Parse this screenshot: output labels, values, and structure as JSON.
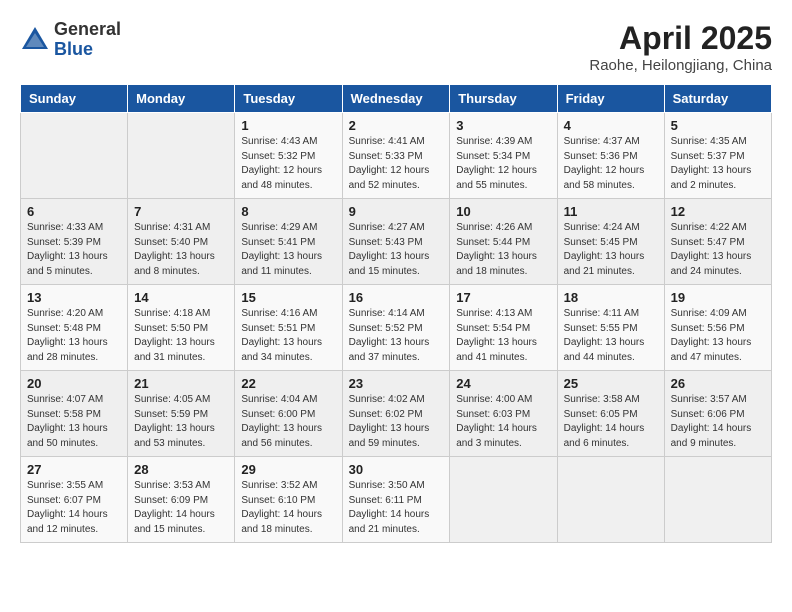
{
  "header": {
    "logo_general": "General",
    "logo_blue": "Blue",
    "title": "April 2025",
    "location": "Raohe, Heilongjiang, China"
  },
  "days_of_week": [
    "Sunday",
    "Monday",
    "Tuesday",
    "Wednesday",
    "Thursday",
    "Friday",
    "Saturday"
  ],
  "weeks": [
    [
      {
        "day": "",
        "info": ""
      },
      {
        "day": "",
        "info": ""
      },
      {
        "day": "1",
        "info": "Sunrise: 4:43 AM\nSunset: 5:32 PM\nDaylight: 12 hours\nand 48 minutes."
      },
      {
        "day": "2",
        "info": "Sunrise: 4:41 AM\nSunset: 5:33 PM\nDaylight: 12 hours\nand 52 minutes."
      },
      {
        "day": "3",
        "info": "Sunrise: 4:39 AM\nSunset: 5:34 PM\nDaylight: 12 hours\nand 55 minutes."
      },
      {
        "day": "4",
        "info": "Sunrise: 4:37 AM\nSunset: 5:36 PM\nDaylight: 12 hours\nand 58 minutes."
      },
      {
        "day": "5",
        "info": "Sunrise: 4:35 AM\nSunset: 5:37 PM\nDaylight: 13 hours\nand 2 minutes."
      }
    ],
    [
      {
        "day": "6",
        "info": "Sunrise: 4:33 AM\nSunset: 5:39 PM\nDaylight: 13 hours\nand 5 minutes."
      },
      {
        "day": "7",
        "info": "Sunrise: 4:31 AM\nSunset: 5:40 PM\nDaylight: 13 hours\nand 8 minutes."
      },
      {
        "day": "8",
        "info": "Sunrise: 4:29 AM\nSunset: 5:41 PM\nDaylight: 13 hours\nand 11 minutes."
      },
      {
        "day": "9",
        "info": "Sunrise: 4:27 AM\nSunset: 5:43 PM\nDaylight: 13 hours\nand 15 minutes."
      },
      {
        "day": "10",
        "info": "Sunrise: 4:26 AM\nSunset: 5:44 PM\nDaylight: 13 hours\nand 18 minutes."
      },
      {
        "day": "11",
        "info": "Sunrise: 4:24 AM\nSunset: 5:45 PM\nDaylight: 13 hours\nand 21 minutes."
      },
      {
        "day": "12",
        "info": "Sunrise: 4:22 AM\nSunset: 5:47 PM\nDaylight: 13 hours\nand 24 minutes."
      }
    ],
    [
      {
        "day": "13",
        "info": "Sunrise: 4:20 AM\nSunset: 5:48 PM\nDaylight: 13 hours\nand 28 minutes."
      },
      {
        "day": "14",
        "info": "Sunrise: 4:18 AM\nSunset: 5:50 PM\nDaylight: 13 hours\nand 31 minutes."
      },
      {
        "day": "15",
        "info": "Sunrise: 4:16 AM\nSunset: 5:51 PM\nDaylight: 13 hours\nand 34 minutes."
      },
      {
        "day": "16",
        "info": "Sunrise: 4:14 AM\nSunset: 5:52 PM\nDaylight: 13 hours\nand 37 minutes."
      },
      {
        "day": "17",
        "info": "Sunrise: 4:13 AM\nSunset: 5:54 PM\nDaylight: 13 hours\nand 41 minutes."
      },
      {
        "day": "18",
        "info": "Sunrise: 4:11 AM\nSunset: 5:55 PM\nDaylight: 13 hours\nand 44 minutes."
      },
      {
        "day": "19",
        "info": "Sunrise: 4:09 AM\nSunset: 5:56 PM\nDaylight: 13 hours\nand 47 minutes."
      }
    ],
    [
      {
        "day": "20",
        "info": "Sunrise: 4:07 AM\nSunset: 5:58 PM\nDaylight: 13 hours\nand 50 minutes."
      },
      {
        "day": "21",
        "info": "Sunrise: 4:05 AM\nSunset: 5:59 PM\nDaylight: 13 hours\nand 53 minutes."
      },
      {
        "day": "22",
        "info": "Sunrise: 4:04 AM\nSunset: 6:00 PM\nDaylight: 13 hours\nand 56 minutes."
      },
      {
        "day": "23",
        "info": "Sunrise: 4:02 AM\nSunset: 6:02 PM\nDaylight: 13 hours\nand 59 minutes."
      },
      {
        "day": "24",
        "info": "Sunrise: 4:00 AM\nSunset: 6:03 PM\nDaylight: 14 hours\nand 3 minutes."
      },
      {
        "day": "25",
        "info": "Sunrise: 3:58 AM\nSunset: 6:05 PM\nDaylight: 14 hours\nand 6 minutes."
      },
      {
        "day": "26",
        "info": "Sunrise: 3:57 AM\nSunset: 6:06 PM\nDaylight: 14 hours\nand 9 minutes."
      }
    ],
    [
      {
        "day": "27",
        "info": "Sunrise: 3:55 AM\nSunset: 6:07 PM\nDaylight: 14 hours\nand 12 minutes."
      },
      {
        "day": "28",
        "info": "Sunrise: 3:53 AM\nSunset: 6:09 PM\nDaylight: 14 hours\nand 15 minutes."
      },
      {
        "day": "29",
        "info": "Sunrise: 3:52 AM\nSunset: 6:10 PM\nDaylight: 14 hours\nand 18 minutes."
      },
      {
        "day": "30",
        "info": "Sunrise: 3:50 AM\nSunset: 6:11 PM\nDaylight: 14 hours\nand 21 minutes."
      },
      {
        "day": "",
        "info": ""
      },
      {
        "day": "",
        "info": ""
      },
      {
        "day": "",
        "info": ""
      }
    ]
  ]
}
